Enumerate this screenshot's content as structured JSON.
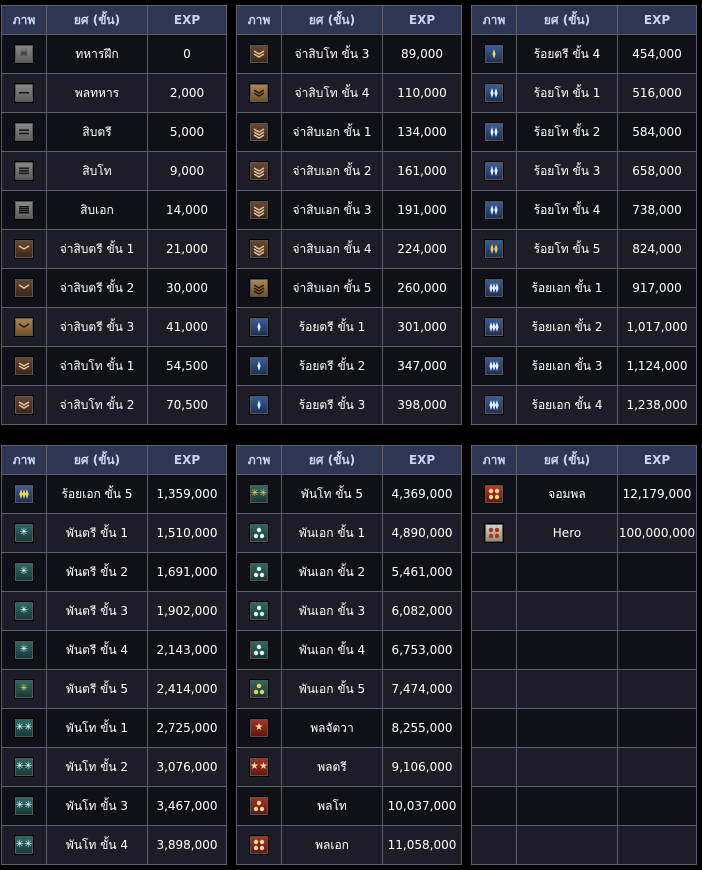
{
  "headers": {
    "image": "ภาพ",
    "rank": "ยศ (ขั้น)",
    "exp": "EXP"
  },
  "tables": [
    {
      "id": "t1",
      "rows": [
        {
          "icon": "skull-icon",
          "cls": "ic-gray",
          "glyph": "☠",
          "rank": "ทหารฝึก",
          "exp": "0"
        },
        {
          "icon": "one-bar-icon",
          "cls": "ic-gray",
          "glyph": "bar1",
          "rank": "พลทหาร",
          "exp": "2,000"
        },
        {
          "icon": "two-bar-icon",
          "cls": "ic-gray",
          "glyph": "bar2",
          "rank": "สิบตรี",
          "exp": "5,000"
        },
        {
          "icon": "three-bar-icon",
          "cls": "ic-gray",
          "glyph": "bar3",
          "rank": "สิบโท",
          "exp": "9,000"
        },
        {
          "icon": "four-bar-icon",
          "cls": "ic-gray",
          "glyph": "bar4",
          "rank": "สิบเอก",
          "exp": "14,000"
        },
        {
          "icon": "chevron-icon",
          "cls": "ic-brown",
          "glyph": "chev1",
          "rank": "จ่าสิบตรี ขั้น 1",
          "exp": "21,000"
        },
        {
          "icon": "chevron-icon",
          "cls": "ic-brown",
          "glyph": "chev1",
          "rank": "จ่าสิบตรี ขั้น 2",
          "exp": "30,000"
        },
        {
          "icon": "chevron-icon",
          "cls": "ic-tan",
          "glyph": "chev1",
          "rank": "จ่าสิบตรี ขั้น 3",
          "exp": "41,000"
        },
        {
          "icon": "double-chevron-icon",
          "cls": "ic-brown",
          "glyph": "chev2",
          "rank": "จ่าสิบโท ขั้น 1",
          "exp": "54,500"
        },
        {
          "icon": "double-chevron-icon",
          "cls": "ic-brown",
          "glyph": "chev2",
          "rank": "จ่าสิบโท ขั้น 2",
          "exp": "70,500"
        }
      ]
    },
    {
      "id": "t2",
      "rows": [
        {
          "icon": "double-chevron-icon",
          "cls": "ic-brown",
          "glyph": "chev2",
          "rank": "จ่าสิบโท ขั้น 3",
          "exp": "89,000"
        },
        {
          "icon": "double-chevron-icon",
          "cls": "ic-tan",
          "glyph": "chev2",
          "rank": "จ่าสิบโท ขั้น 4",
          "exp": "110,000"
        },
        {
          "icon": "triple-chevron-icon",
          "cls": "ic-brown",
          "glyph": "chev3",
          "rank": "จ่าสิบเอก ขั้น 1",
          "exp": "134,000"
        },
        {
          "icon": "triple-chevron-icon",
          "cls": "ic-brown",
          "glyph": "chev3",
          "rank": "จ่าสิบเอก ขั้น 2",
          "exp": "161,000"
        },
        {
          "icon": "triple-chevron-icon",
          "cls": "ic-brown",
          "glyph": "chev3",
          "rank": "จ่าสิบเอก ขั้น 3",
          "exp": "191,000"
        },
        {
          "icon": "triple-chevron-icon",
          "cls": "ic-brown",
          "glyph": "chev3",
          "rank": "จ่าสิบเอก ขั้น 4",
          "exp": "224,000"
        },
        {
          "icon": "triple-chevron-icon",
          "cls": "ic-tan",
          "glyph": "chev3",
          "rank": "จ่าสิบเอก ขั้น 5",
          "exp": "260,000"
        },
        {
          "icon": "single-arrow-icon",
          "cls": "ic-blue",
          "glyph": "arr1",
          "rank": "ร้อยตรี ขั้น 1",
          "exp": "301,000"
        },
        {
          "icon": "single-arrow-icon",
          "cls": "ic-blue",
          "glyph": "arr1",
          "rank": "ร้อยตรี ขั้น 2",
          "exp": "347,000"
        },
        {
          "icon": "single-arrow-icon",
          "cls": "ic-blue",
          "glyph": "arr1",
          "rank": "ร้อยตรี ขั้น 3",
          "exp": "398,000"
        }
      ]
    },
    {
      "id": "t3",
      "rows": [
        {
          "icon": "single-arrow-icon",
          "cls": "ic-gold-blue",
          "glyph": "arr1",
          "rank": "ร้อยตรี ขั้น 4",
          "exp": "454,000"
        },
        {
          "icon": "double-arrow-icon",
          "cls": "ic-blue",
          "glyph": "arr2",
          "rank": "ร้อยโท ขั้น 1",
          "exp": "516,000"
        },
        {
          "icon": "double-arrow-icon",
          "cls": "ic-blue",
          "glyph": "arr2",
          "rank": "ร้อยโท ขั้น 2",
          "exp": "584,000"
        },
        {
          "icon": "double-arrow-icon",
          "cls": "ic-blue",
          "glyph": "arr2",
          "rank": "ร้อยโท ขั้น 3",
          "exp": "658,000"
        },
        {
          "icon": "double-arrow-icon",
          "cls": "ic-blue",
          "glyph": "arr2",
          "rank": "ร้อยโท ขั้น 4",
          "exp": "738,000"
        },
        {
          "icon": "double-arrow-icon",
          "cls": "ic-gold-blue",
          "glyph": "arr2",
          "rank": "ร้อยโท ขั้น 5",
          "exp": "824,000"
        },
        {
          "icon": "triple-arrow-icon",
          "cls": "ic-blue",
          "glyph": "arr3",
          "rank": "ร้อยเอก ขั้น 1",
          "exp": "917,000"
        },
        {
          "icon": "triple-arrow-icon",
          "cls": "ic-blue",
          "glyph": "arr3",
          "rank": "ร้อยเอก ขั้น 2",
          "exp": "1,017,000"
        },
        {
          "icon": "triple-arrow-icon",
          "cls": "ic-blue",
          "glyph": "arr3",
          "rank": "ร้อยเอก ขั้น 3",
          "exp": "1,124,000"
        },
        {
          "icon": "triple-arrow-icon",
          "cls": "ic-blue",
          "glyph": "arr3",
          "rank": "ร้อยเอก ขั้น 4",
          "exp": "1,238,000"
        }
      ]
    },
    {
      "id": "t4",
      "rows": [
        {
          "icon": "triple-arrow-icon",
          "cls": "ic-gold-blue",
          "glyph": "arr3",
          "rank": "ร้อยเอก ขั้น 5",
          "exp": "1,359,000"
        },
        {
          "icon": "star-icon",
          "cls": "ic-teal",
          "glyph": "✳",
          "rank": "พันตรี ขั้น 1",
          "exp": "1,510,000"
        },
        {
          "icon": "star-icon",
          "cls": "ic-teal",
          "glyph": "✳",
          "rank": "พันตรี ขั้น 2",
          "exp": "1,691,000"
        },
        {
          "icon": "star-icon",
          "cls": "ic-teal",
          "glyph": "✳",
          "rank": "พันตรี ขั้น 3",
          "exp": "1,902,000"
        },
        {
          "icon": "star-icon",
          "cls": "ic-teal",
          "glyph": "✳",
          "rank": "พันตรี ขั้น 4",
          "exp": "2,143,000"
        },
        {
          "icon": "star-icon",
          "cls": "ic-gold-teal",
          "glyph": "✳",
          "rank": "พันตรี ขั้น 5",
          "exp": "2,414,000"
        },
        {
          "icon": "double-star-icon",
          "cls": "ic-teal",
          "glyph": "✳✳",
          "rank": "พันโท ขั้น 1",
          "exp": "2,725,000"
        },
        {
          "icon": "double-star-icon",
          "cls": "ic-teal",
          "glyph": "✳✳",
          "rank": "พันโท ขั้น 2",
          "exp": "3,076,000"
        },
        {
          "icon": "double-star-icon",
          "cls": "ic-teal",
          "glyph": "✳✳",
          "rank": "พันโท ขั้น 3",
          "exp": "3,467,000"
        },
        {
          "icon": "double-star-icon",
          "cls": "ic-teal",
          "glyph": "✳✳",
          "rank": "พันโท ขั้น 4",
          "exp": "3,898,000"
        }
      ]
    },
    {
      "id": "t5",
      "rows": [
        {
          "icon": "double-star-icon",
          "cls": "ic-gold-teal",
          "glyph": "✳✳",
          "rank": "พันโท ขั้น 5",
          "exp": "4,369,000"
        },
        {
          "icon": "triple-star-icon",
          "cls": "ic-teal",
          "glyph": "tri",
          "rank": "พันเอก ขั้น 1",
          "exp": "4,890,000"
        },
        {
          "icon": "triple-star-icon",
          "cls": "ic-teal",
          "glyph": "tri",
          "rank": "พันเอก ขั้น 2",
          "exp": "5,461,000"
        },
        {
          "icon": "triple-star-icon",
          "cls": "ic-teal",
          "glyph": "tri",
          "rank": "พันเอก ขั้น 3",
          "exp": "6,082,000"
        },
        {
          "icon": "triple-star-icon",
          "cls": "ic-teal",
          "glyph": "tri",
          "rank": "พันเอก ขั้น 4",
          "exp": "6,753,000"
        },
        {
          "icon": "triple-star-icon",
          "cls": "ic-gold-teal",
          "glyph": "tri",
          "rank": "พันเอก ขั้น 5",
          "exp": "7,474,000"
        },
        {
          "icon": "general-star-icon",
          "cls": "ic-red",
          "glyph": "★",
          "rank": "พลจัตวา",
          "exp": "8,255,000"
        },
        {
          "icon": "general-two-star-icon",
          "cls": "ic-red",
          "glyph": "★★",
          "rank": "พลตรี",
          "exp": "9,106,000"
        },
        {
          "icon": "general-three-star-icon",
          "cls": "ic-red",
          "glyph": "tri",
          "rank": "พลโท",
          "exp": "10,037,000"
        },
        {
          "icon": "general-four-star-icon",
          "cls": "ic-red",
          "glyph": "quad",
          "rank": "พลเอก",
          "exp": "11,058,000"
        }
      ]
    },
    {
      "id": "t6",
      "rows": [
        {
          "icon": "marshal-icon",
          "cls": "ic-redgold",
          "glyph": "quad",
          "rank": "จอมพล",
          "exp": "12,179,000"
        },
        {
          "icon": "hero-icon",
          "cls": "ic-white",
          "glyph": "quad",
          "rank": "Hero",
          "exp": "100,000,000"
        },
        {
          "icon": "",
          "cls": "",
          "glyph": "",
          "rank": "",
          "exp": ""
        },
        {
          "icon": "",
          "cls": "",
          "glyph": "",
          "rank": "",
          "exp": ""
        },
        {
          "icon": "",
          "cls": "",
          "glyph": "",
          "rank": "",
          "exp": ""
        },
        {
          "icon": "",
          "cls": "",
          "glyph": "",
          "rank": "",
          "exp": ""
        },
        {
          "icon": "",
          "cls": "",
          "glyph": "",
          "rank": "",
          "exp": ""
        },
        {
          "icon": "",
          "cls": "",
          "glyph": "",
          "rank": "",
          "exp": ""
        },
        {
          "icon": "",
          "cls": "",
          "glyph": "",
          "rank": "",
          "exp": ""
        },
        {
          "icon": "",
          "cls": "",
          "glyph": "",
          "rank": "",
          "exp": ""
        }
      ]
    }
  ]
}
